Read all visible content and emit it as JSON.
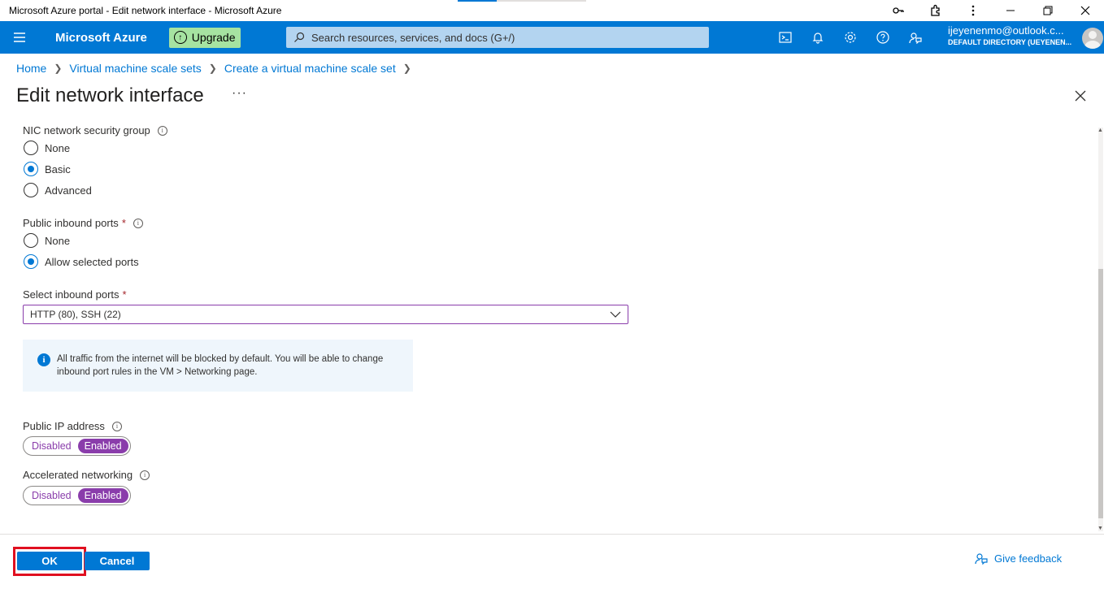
{
  "window": {
    "title": "Microsoft Azure portal - Edit network interface - Microsoft Azure"
  },
  "topbar": {
    "brand": "Microsoft Azure",
    "upgrade_label": "Upgrade",
    "search_placeholder": "Search resources, services, and docs (G+/)",
    "account_email": "ijeyenenmo@outlook.c...",
    "account_directory": "DEFAULT DIRECTORY (UEYENEN..."
  },
  "breadcrumb": {
    "items": [
      "Home",
      "Virtual machine scale sets",
      "Create a virtual machine scale set"
    ]
  },
  "page": {
    "title": "Edit network interface",
    "more_label": "···"
  },
  "form": {
    "nsg": {
      "label": "NIC network security group",
      "options": [
        "None",
        "Basic",
        "Advanced"
      ],
      "selected": "Basic"
    },
    "public_inbound": {
      "label": "Public inbound ports",
      "required_mark": "*",
      "options": [
        "None",
        "Allow selected ports"
      ],
      "selected": "Allow selected ports"
    },
    "select_ports": {
      "label": "Select inbound ports",
      "required_mark": "*",
      "value": "HTTP (80), SSH (22)"
    },
    "info_text": "All traffic from the internet will be blocked by default. You will be able to change inbound port rules in the VM > Networking page.",
    "public_ip": {
      "label": "Public IP address",
      "options": [
        "Disabled",
        "Enabled"
      ],
      "selected": "Enabled"
    },
    "accelerated": {
      "label": "Accelerated networking",
      "options": [
        "Disabled",
        "Enabled"
      ],
      "selected": "Enabled"
    }
  },
  "footer": {
    "ok_label": "OK",
    "cancel_label": "Cancel",
    "feedback_label": "Give feedback"
  },
  "colors": {
    "accent": "#0078d4",
    "toggle_on": "#8a3dab",
    "highlight": "#e01020"
  }
}
